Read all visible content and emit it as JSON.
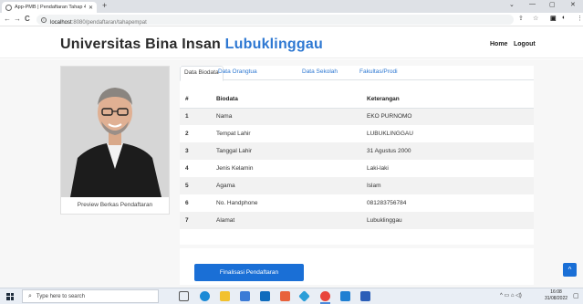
{
  "browser": {
    "tab_title": "App-PMB | Pendaftaran Tahap 4",
    "url_host": "localhost",
    "url_path": ":8080/pendaftaran/tahapempat"
  },
  "header": {
    "brand_main": "Universitas Bina Insan ",
    "brand_accent": "Lubuklinggau",
    "nav_home": "Home",
    "nav_logout": "Logout"
  },
  "profile": {
    "caption": "Preview Berkas Pendaftaran"
  },
  "tabs": [
    {
      "label": "Data Biodata",
      "active": true
    },
    {
      "label": "Data Orangtua"
    },
    {
      "label": "Data Sekolah"
    },
    {
      "label": "Fakultas/Prodi"
    }
  ],
  "table": {
    "headers": [
      "#",
      "Biodata",
      "Keterangan"
    ],
    "rows": [
      [
        "1",
        "Nama",
        "EKO PURNOMO"
      ],
      [
        "2",
        "Tempat Lahir",
        "LUBUKLINGGAU"
      ],
      [
        "3",
        "Tanggal Lahir",
        "31 Agustus 2000"
      ],
      [
        "4",
        "Jenis Kelamin",
        "Laki-laki"
      ],
      [
        "5",
        "Agama",
        "Islam"
      ],
      [
        "6",
        "No. Handphone",
        "081283756784"
      ],
      [
        "7",
        "Alamat",
        "Lubuklinggau"
      ]
    ]
  },
  "actions": {
    "submit_label": "Finalisasi Pendaftaran"
  },
  "taskbar": {
    "search_placeholder": "Type here to search",
    "time": "16:08",
    "date": "31/08/2022"
  },
  "colors": {
    "accent": "#2e78d2",
    "button": "#1a6fd6"
  }
}
